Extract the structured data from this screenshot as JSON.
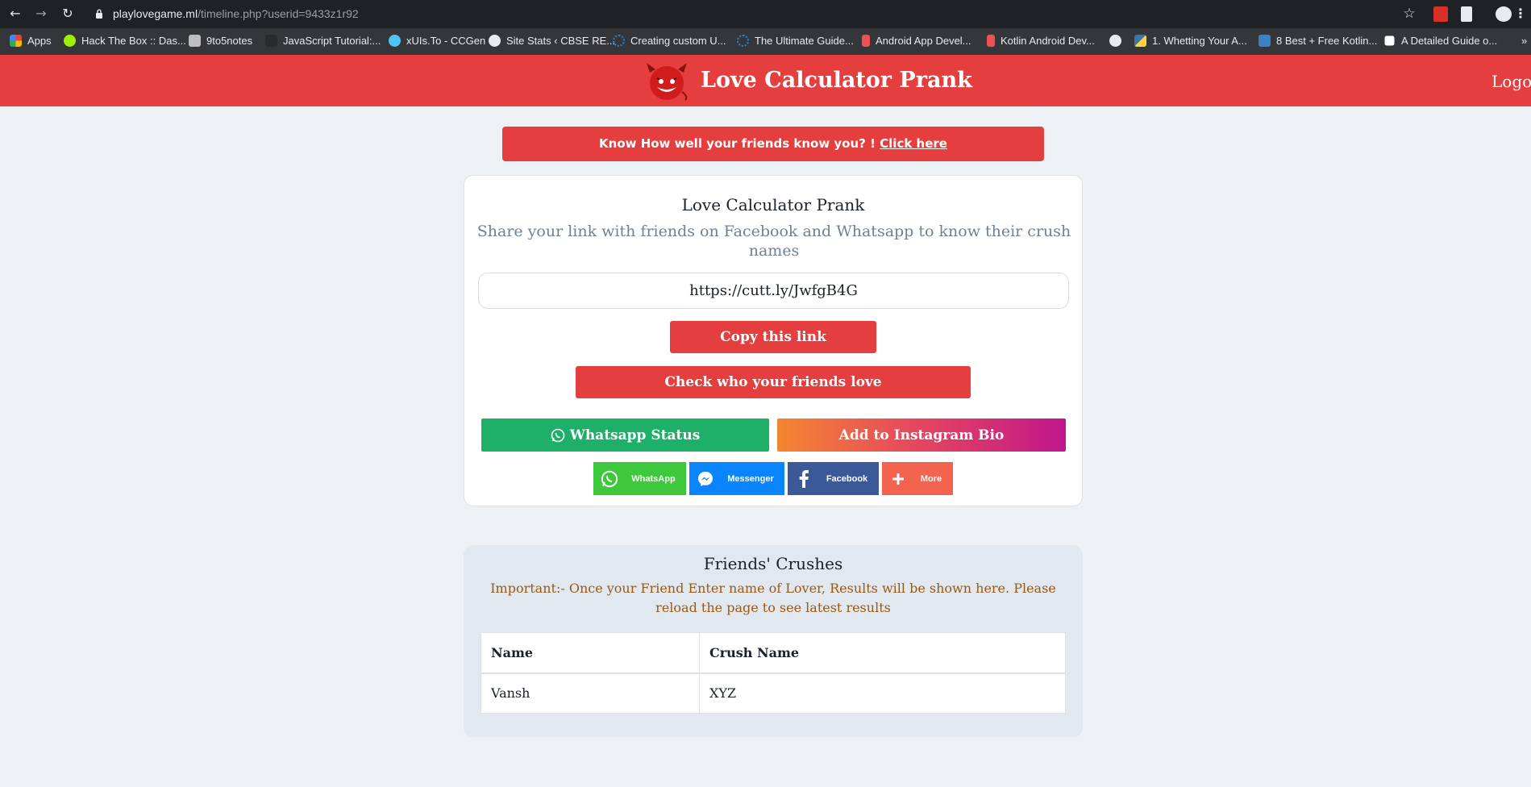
{
  "browser": {
    "url_domain": "playlovegame.ml",
    "url_path": "/timeline.php?userid=9433z1r92",
    "bookmarks": [
      {
        "label": "Apps",
        "icon": "apps-grid-icon",
        "color": "#ea4335"
      },
      {
        "label": "Hack The Box :: Das...",
        "icon": "hackthebox-icon",
        "color": "#9fef00"
      },
      {
        "label": "9to5notes",
        "icon": "9to5notes-icon",
        "color": "#bdbdbd"
      },
      {
        "label": "JavaScript Tutorial:...",
        "icon": "javascript-icon",
        "color": "#2b2b2b"
      },
      {
        "label": "xUIs.To - CCGen",
        "icon": "xuis-icon",
        "color": "#4fc3f7"
      },
      {
        "label": "Site Stats ‹ CBSE RE...",
        "icon": "globe-icon",
        "color": "#e8eaed"
      },
      {
        "label": "Creating custom U...",
        "icon": "spinner-icon",
        "color": "#1e88e5"
      },
      {
        "label": "The Ultimate Guide...",
        "icon": "spinner-icon",
        "color": "#1e88e5"
      },
      {
        "label": "Android App Devel...",
        "icon": "udemy-icon",
        "color": "#ec5252"
      },
      {
        "label": "Kotlin Android Dev...",
        "icon": "udemy-icon",
        "color": "#ec5252"
      },
      {
        "label": "",
        "icon": "globe-icon",
        "color": "#e8eaed"
      },
      {
        "label": "1. Whetting Your A...",
        "icon": "python-icon",
        "color": "#ffd43b"
      },
      {
        "label": "8 Best + Free Kotlin...",
        "icon": "dc-icon",
        "color": "#3b82c4"
      },
      {
        "label": "A Detailed Guide o...",
        "icon": "diamond-icon",
        "color": "#ffffff"
      }
    ]
  },
  "header": {
    "title": "Love Calculator Prank",
    "logout": "Logout",
    "logo": "devil-smiley-icon",
    "color": "#e53e3e"
  },
  "banner": {
    "text": "Know How well your friends know you? ! ",
    "link": "Click here"
  },
  "card": {
    "title": "Love Calculator Prank",
    "subtitle": "Share your link with friends on Facebook and Whatsapp to know their crush names",
    "share_link": "https://cutt.ly/JwfgB4G",
    "copy_button": "Copy this link",
    "check_button": "Check who your friends love",
    "whatsapp_status": "Whatsapp Status",
    "instagram_bio": "Add to Instagram Bio",
    "share_buttons": [
      {
        "label": "WhatsApp",
        "icon": "whatsapp-icon",
        "color": "#3ec83c"
      },
      {
        "label": "Messenger",
        "icon": "messenger-icon",
        "color": "#0a84ff"
      },
      {
        "label": "Facebook",
        "icon": "facebook-icon",
        "color": "#3b5998"
      },
      {
        "label": "More",
        "icon": "plus-icon",
        "color": "#f26450"
      }
    ]
  },
  "crushes": {
    "title": "Friends' Crushes",
    "note": "Important:- Once your Friend Enter name of Lover, Results will be shown here. Please reload the page to see latest results",
    "columns": [
      "Name",
      "Crush Name"
    ],
    "rows": [
      [
        "Vansh",
        "XYZ"
      ]
    ]
  }
}
